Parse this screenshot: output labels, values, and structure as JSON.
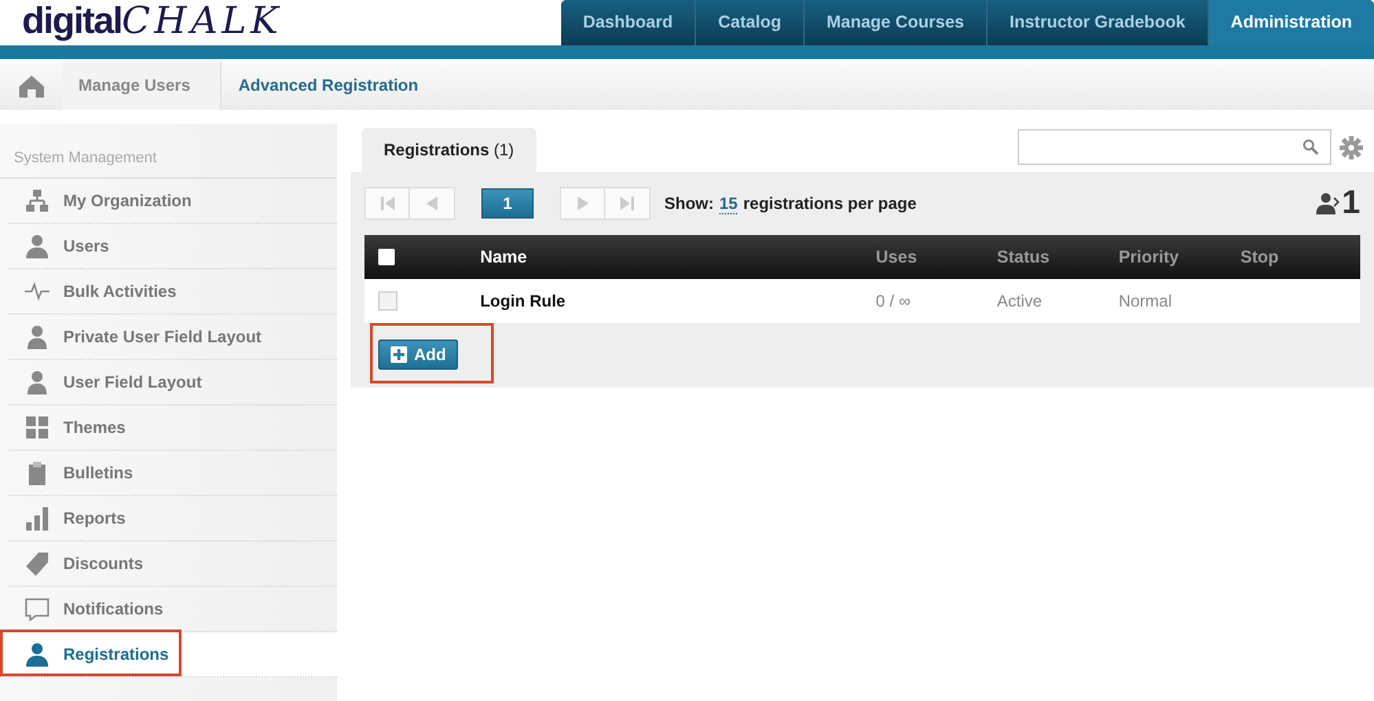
{
  "logo": {
    "part1": "digital",
    "part2": "CHALK"
  },
  "nav_tabs": [
    {
      "label": "Dashboard",
      "selected": false
    },
    {
      "label": "Catalog",
      "selected": false
    },
    {
      "label": "Manage Courses",
      "selected": false
    },
    {
      "label": "Instructor Gradebook",
      "selected": false
    },
    {
      "label": "Administration",
      "selected": true
    }
  ],
  "breadcrumb": [
    "Manage Users",
    "Advanced Registration"
  ],
  "sidebar": {
    "heading": "System Management",
    "items": [
      {
        "label": "My Organization",
        "kind": "org",
        "selected": false,
        "highlighted": false
      },
      {
        "label": "Users",
        "kind": "user",
        "selected": false,
        "highlighted": false
      },
      {
        "label": "Bulk Activities",
        "kind": "pulse",
        "selected": false,
        "highlighted": false
      },
      {
        "label": "Private User Field Layout",
        "kind": "userform",
        "selected": false,
        "highlighted": false
      },
      {
        "label": "User Field Layout",
        "kind": "userform",
        "selected": false,
        "highlighted": false
      },
      {
        "label": "Themes",
        "kind": "grid",
        "selected": false,
        "highlighted": false
      },
      {
        "label": "Bulletins",
        "kind": "clipboard",
        "selected": false,
        "highlighted": false
      },
      {
        "label": "Reports",
        "kind": "bars",
        "selected": false,
        "highlighted": false
      },
      {
        "label": "Discounts",
        "kind": "tag",
        "selected": false,
        "highlighted": false
      },
      {
        "label": "Notifications",
        "kind": "note",
        "selected": false,
        "highlighted": false
      },
      {
        "label": "Registrations",
        "kind": "user",
        "selected": true,
        "highlighted": true
      }
    ]
  },
  "content_tab": {
    "label": "Registrations",
    "count": "(1)"
  },
  "pager": {
    "page": "1",
    "show_label": "Show:",
    "per_page": "15",
    "per_page_suffix": "registrations per page",
    "total": "1"
  },
  "table": {
    "columns": [
      "Name",
      "Uses",
      "Status",
      "Priority",
      "Stop"
    ],
    "select_all_checked": false,
    "rows": [
      {
        "checked": false,
        "name": "Login Rule",
        "uses": "0 / ∞",
        "status": "Active",
        "priority": "Normal"
      }
    ]
  },
  "add_button": {
    "label": "Add",
    "highlighted": true
  }
}
